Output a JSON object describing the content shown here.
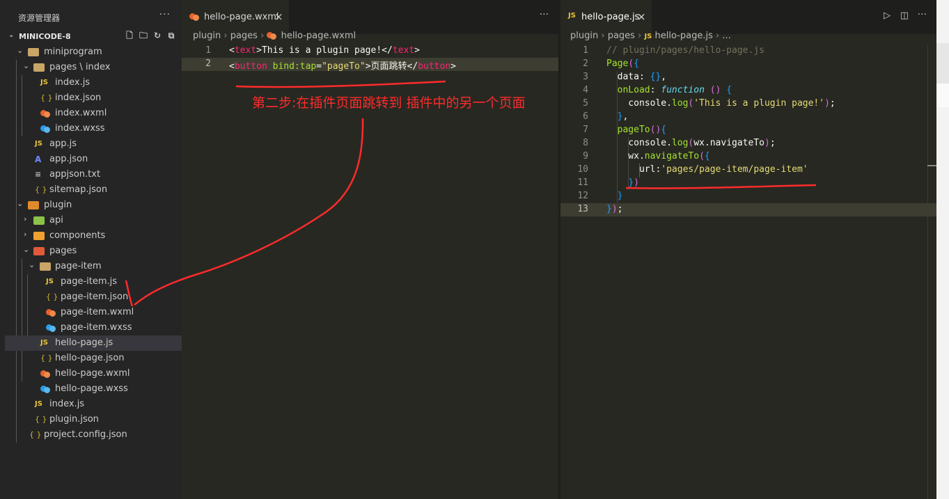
{
  "sidebar": {
    "title": "资源管理器",
    "more": "···",
    "section": "MINICODE-8",
    "items": [
      {
        "label": "miniprogram"
      },
      {
        "label": "pages \\ index"
      },
      {
        "label": "index.js"
      },
      {
        "label": "index.json"
      },
      {
        "label": "index.wxml"
      },
      {
        "label": "index.wxss"
      },
      {
        "label": "app.js"
      },
      {
        "label": "app.json"
      },
      {
        "label": "appjson.txt"
      },
      {
        "label": "sitemap.json"
      },
      {
        "label": "plugin"
      },
      {
        "label": "api"
      },
      {
        "label": "components"
      },
      {
        "label": "pages"
      },
      {
        "label": "page-item"
      },
      {
        "label": "page-item.js"
      },
      {
        "label": "page-item.json"
      },
      {
        "label": "page-item.wxml"
      },
      {
        "label": "page-item.wxss"
      },
      {
        "label": "hello-page.js"
      },
      {
        "label": "hello-page.json"
      },
      {
        "label": "hello-page.wxml"
      },
      {
        "label": "hello-page.wxss"
      },
      {
        "label": "index.js"
      },
      {
        "label": "plugin.json"
      },
      {
        "label": "project.config.json"
      }
    ]
  },
  "editor1": {
    "tab": "hello-page.wxml",
    "more": "···",
    "breadcrumb": [
      "plugin",
      "pages",
      "hello-page.wxml"
    ],
    "line_numbers": [
      "1",
      "2"
    ]
  },
  "editor2": {
    "tab": "hello-page.js",
    "breadcrumb": [
      "plugin",
      "pages",
      "hello-page.js",
      "..."
    ],
    "line_numbers": [
      "1",
      "2",
      "3",
      "4",
      "5",
      "6",
      "7",
      "8",
      "9",
      "10",
      "11",
      "12",
      "13"
    ]
  },
  "code_tokens": {
    "t_lt": "<",
    "t_text": "text",
    "t_gt": ">",
    "t_body": "This is a plugin page!",
    "t_close_open": "</",
    "b_button": "button",
    "b_attr": "bind:tap",
    "b_eq": "=",
    "b_val": "\"pageTo\"",
    "b_label": "页面跳转"
  },
  "js_lines": [
    "// plugin/pages/hello-page.js",
    "Page({",
    "  data: {},",
    "  onLoad: function () {",
    "    console.log('This is a plugin page!');",
    "  },",
    "  pageTo(){",
    "    console.log(wx.navigateTo);",
    "    wx.navigateTo({",
    "      url:'pages/page-item/page-item'",
    "    })",
    "  }",
    "});"
  ],
  "annotation": "第二步:在插件页面跳转到 插件中的另一个页面",
  "icons": {
    "js": "JS",
    "json": "{ }"
  },
  "colors": {
    "annotation": "#ff2b2b",
    "accent": "#e8c53b"
  }
}
